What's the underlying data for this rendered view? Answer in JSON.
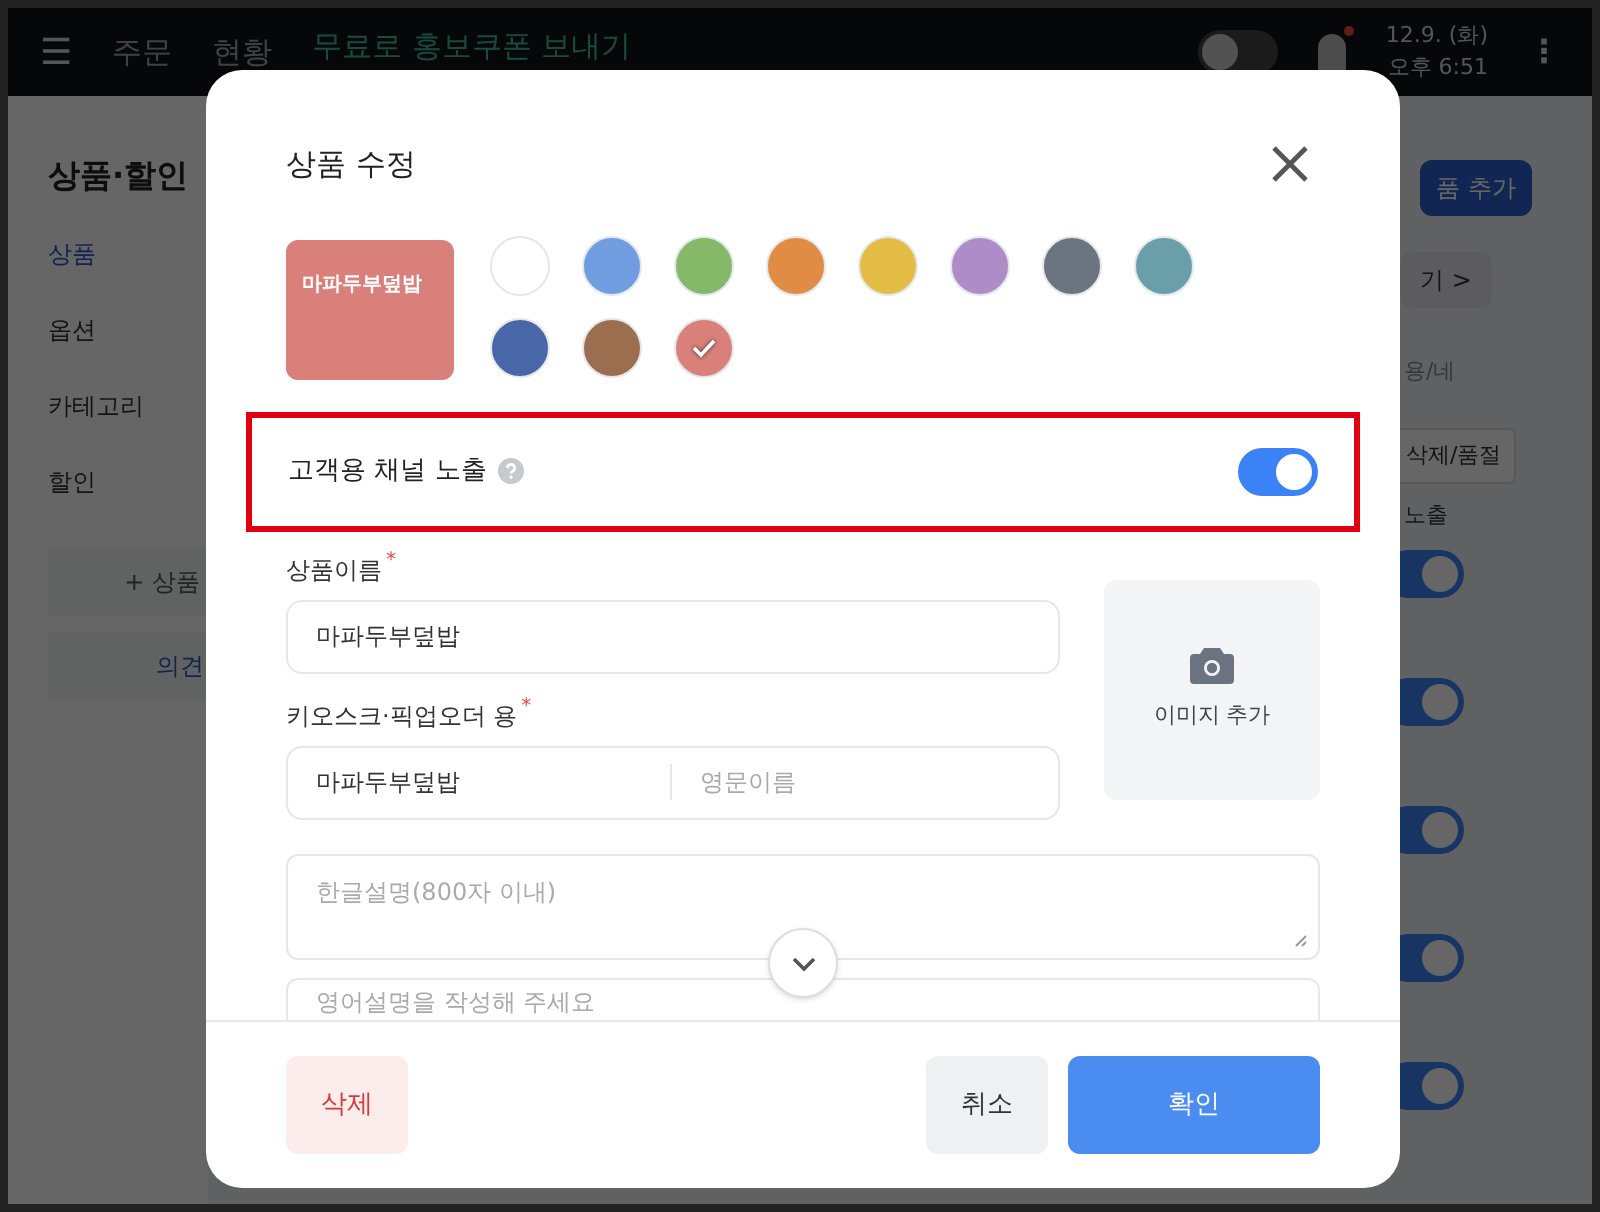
{
  "top_bar": {
    "menu_icon": "☰",
    "tabs": [
      {
        "label": "주문",
        "selected": false
      },
      {
        "label": "현황",
        "selected": false
      }
    ],
    "promo": "무료로 홍보쿠폰 보내기",
    "date": "12.9. (화)",
    "time": "오후 6:51",
    "more_icon": "⋮"
  },
  "sidebar": {
    "title": "상품·할인",
    "items": [
      {
        "label": "상품",
        "selected": true
      },
      {
        "label": "옵션",
        "selected": false
      },
      {
        "label": "카테고리",
        "selected": false
      },
      {
        "label": "할인",
        "selected": false
      }
    ],
    "add_button": "+ 상품",
    "feedback_button": "의견"
  },
  "main": {
    "add_button": "품 추가",
    "link": "기 >",
    "dropdown": "용/네",
    "delete_button": "삭제/품절",
    "column_header": "노출",
    "rows": [
      {
        "on": true
      },
      {
        "on": true
      },
      {
        "on": true
      },
      {
        "on": true
      },
      {
        "on": true
      }
    ]
  },
  "modal": {
    "title": "상품 수정",
    "preview": {
      "label": "마파두부덮밥",
      "color": "#d9807a"
    },
    "swatches": [
      {
        "color": "#ffffff",
        "selected": false
      },
      {
        "color": "#6f9de0",
        "selected": false
      },
      {
        "color": "#86b86a",
        "selected": false
      },
      {
        "color": "#e08c45",
        "selected": false
      },
      {
        "color": "#e3bd45",
        "selected": false
      },
      {
        "color": "#ae8cc8",
        "selected": false
      },
      {
        "color": "#6c7480",
        "selected": false
      },
      {
        "color": "#6a9faa",
        "selected": false
      },
      {
        "color": "#4966a8",
        "selected": false
      },
      {
        "color": "#9a6e4f",
        "selected": false
      },
      {
        "color": "#d9807a",
        "selected": true
      }
    ],
    "channel_toggle": {
      "label": "고객용 채널 노출",
      "on": true
    },
    "name_field": {
      "label": "상품이름",
      "required_mark": "*",
      "value": "마파두부덮밥"
    },
    "kiosk_field": {
      "label": "키오스크·픽업오더 용",
      "required_mark": "*",
      "value": "마파두부덮밥",
      "placeholder": "영문이름"
    },
    "image_button": "이미지 추가",
    "korean_description": {
      "placeholder": "한글설명(800자 이내)"
    },
    "english_description": {
      "placeholder": "영어설명을 작성해 주세요"
    },
    "buttons": {
      "delete": "삭제",
      "cancel": "취소",
      "confirm": "확인"
    }
  }
}
